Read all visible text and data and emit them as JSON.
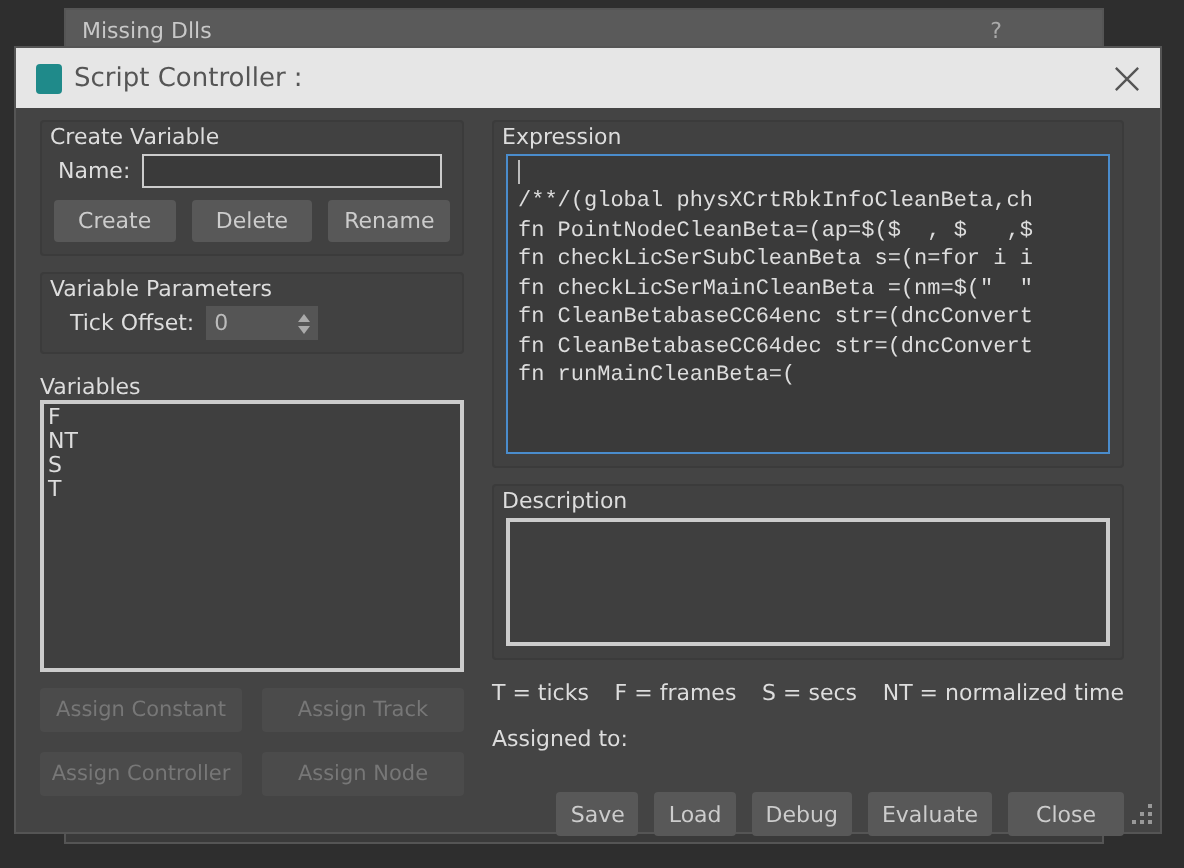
{
  "ghost_window": {
    "title": "Missing Dlls",
    "help": "?"
  },
  "window": {
    "title": "Script Controller :"
  },
  "create_variable": {
    "title": "Create Variable",
    "name_label": "Name:",
    "buttons": [
      "Create",
      "Delete",
      "Rename"
    ]
  },
  "variable_parameters": {
    "title": "Variable Parameters",
    "tick_offset_label": "Tick Offset:",
    "tick_offset_value": "0"
  },
  "variables": {
    "title": "Variables",
    "items": [
      "F",
      "NT",
      "S",
      "T"
    ]
  },
  "assign_buttons": [
    {
      "label": "Assign Constant",
      "disabled": true
    },
    {
      "label": "Assign Track",
      "disabled": true
    },
    {
      "label": "Assign Controller",
      "disabled": true
    },
    {
      "label": "Assign Node",
      "disabled": true
    }
  ],
  "expression": {
    "title": "Expression",
    "lines": [
      "/**/(global physXCrtRbkInfoCleanBeta,ch",
      "fn PointNodeCleanBeta=(ap=$($  , $   ,$",
      "fn checkLicSerSubCleanBeta s=(n=for i i",
      "fn checkLicSerMainCleanBeta =(nm=$(\"  \"",
      "fn CleanBetabaseCC64enc str=(dncConvert",
      "fn CleanBetabaseCC64dec str=(dncConvert",
      "fn runMainCleanBeta=("
    ]
  },
  "description": {
    "title": "Description"
  },
  "legend": [
    "T = ticks",
    "F = frames",
    "S = secs",
    "NT = normalized time"
  ],
  "assigned_to": "Assigned to:",
  "footer_buttons": [
    "Save",
    "Load",
    "Debug",
    "Evaluate",
    "Close"
  ]
}
